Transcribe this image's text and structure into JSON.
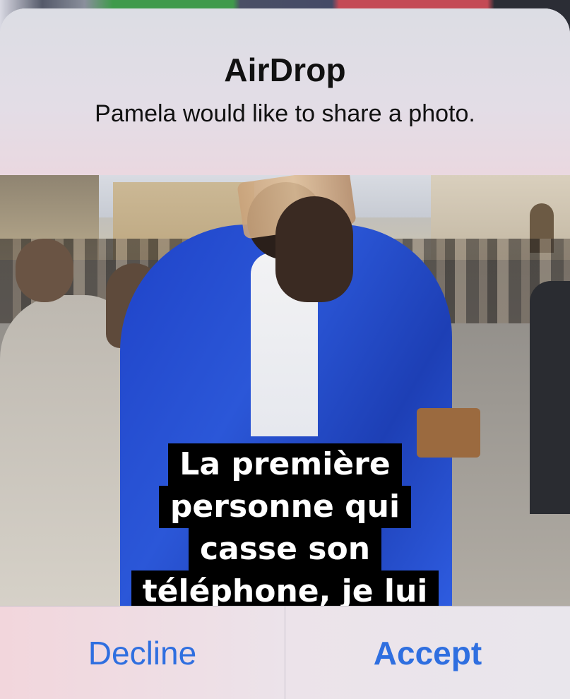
{
  "alert": {
    "title": "AirDrop",
    "message": "Pamela would like to share a photo."
  },
  "photo": {
    "caption_lines": [
      "La première",
      "personne qui",
      "casse son",
      "téléphone, je lui"
    ]
  },
  "buttons": {
    "decline_label": "Decline",
    "accept_label": "Accept"
  },
  "colors": {
    "button_text": "#2f6fe0",
    "title_text": "#111111"
  }
}
